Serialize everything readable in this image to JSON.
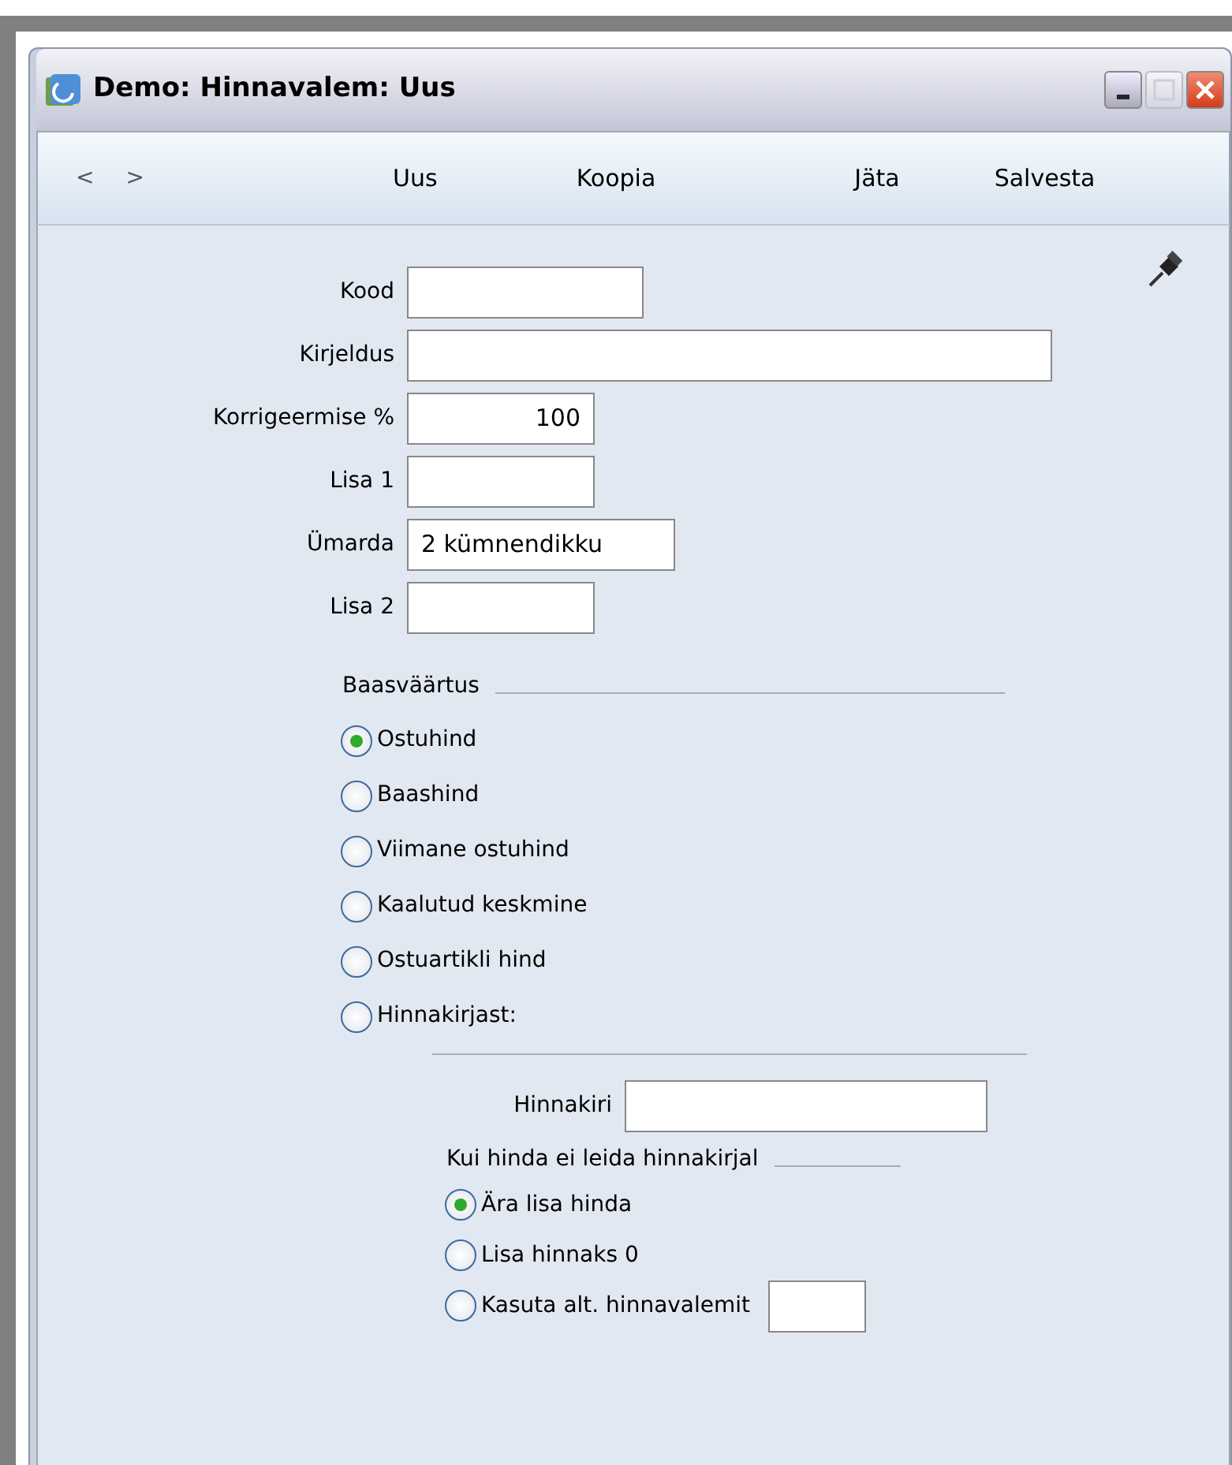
{
  "window": {
    "title": "Demo: Hinnavalem: Uus"
  },
  "toolbar": {
    "nav": [
      "<",
      ">"
    ],
    "actions": [
      "Uus",
      "Koopia",
      "Jäta",
      "Salvesta"
    ]
  },
  "fields": [
    {
      "label": "Kood",
      "kind": "short"
    },
    {
      "label": "Kirjeldus",
      "kind": "long"
    },
    {
      "label": "Korrigeermise %",
      "kind": "number",
      "value": "100"
    },
    {
      "label": "Lisa 1",
      "kind": "number"
    },
    {
      "label": "Ümarda",
      "kind": "choice",
      "value": "2 kümnendikku"
    },
    {
      "label": "Lisa 2",
      "kind": "number"
    }
  ],
  "base_value": {
    "title": "Baasväärtus",
    "options": [
      {
        "label": "Ostuhind",
        "selected": true
      },
      {
        "label": "Baashind",
        "selected": false
      },
      {
        "label": "Viimane ostuhind",
        "selected": false
      },
      {
        "label": "Kaalutud keskmine",
        "selected": false
      },
      {
        "label": "Ostuartikli hind",
        "selected": false
      },
      {
        "label": "Hinnakirjast:",
        "selected": false
      }
    ]
  },
  "price_list": {
    "label": "Hinnakiri"
  },
  "not_found": {
    "title": "Kui hinda ei leida hinnakirjal",
    "options": [
      {
        "label": "Ära lisa hinda",
        "selected": true,
        "kind": "plain"
      },
      {
        "label": "Lisa hinnaks 0",
        "selected": false,
        "kind": "plain"
      },
      {
        "label": "Kasuta alt. hinnavalemit",
        "selected": false,
        "kind": "with_field"
      }
    ]
  }
}
